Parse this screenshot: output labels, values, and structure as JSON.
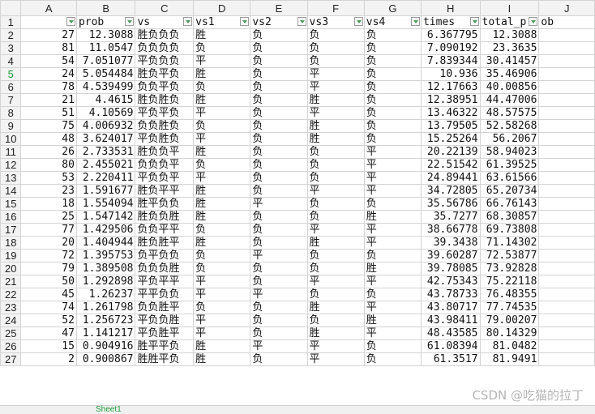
{
  "columns": [
    "A",
    "B",
    "C",
    "D",
    "E",
    "F",
    "G",
    "H",
    "I",
    "J"
  ],
  "header_row": {
    "row": "1",
    "cells": [
      "",
      "prob",
      "vs",
      "vs1",
      "vs2",
      "vs3",
      "vs4",
      "times",
      "total_p",
      "ob"
    ]
  },
  "rows": [
    {
      "n": "2",
      "c": [
        "27",
        "12.3088",
        "胜负负负",
        "胜",
        "负",
        "负",
        "负",
        "6.367795",
        "12.3088",
        ""
      ]
    },
    {
      "n": "3",
      "c": [
        "81",
        "11.0547",
        "负负负负",
        "负",
        "负",
        "负",
        "负",
        "7.090192",
        "23.3635",
        ""
      ]
    },
    {
      "n": "4",
      "c": [
        "54",
        "7.051077",
        "平负负负",
        "平",
        "负",
        "负",
        "负",
        "7.839344",
        "30.41457",
        ""
      ]
    },
    {
      "n": "5",
      "c": [
        "24",
        "5.054484",
        "胜负平负",
        "胜",
        "负",
        "平",
        "负",
        "10.936",
        "35.46906",
        ""
      ]
    },
    {
      "n": "6",
      "c": [
        "78",
        "4.539499",
        "负负平负",
        "负",
        "负",
        "平",
        "负",
        "12.17663",
        "40.00856",
        ""
      ]
    },
    {
      "n": "7",
      "c": [
        "21",
        "4.4615",
        "胜负胜负",
        "胜",
        "负",
        "胜",
        "负",
        "12.38951",
        "44.47006",
        ""
      ]
    },
    {
      "n": "8",
      "c": [
        "51",
        "4.10569",
        "平负平负",
        "平",
        "负",
        "平",
        "负",
        "13.46322",
        "48.57575",
        ""
      ]
    },
    {
      "n": "9",
      "c": [
        "75",
        "4.006932",
        "负负胜负",
        "负",
        "负",
        "胜",
        "负",
        "13.79505",
        "52.58268",
        ""
      ]
    },
    {
      "n": "10",
      "c": [
        "48",
        "3.624017",
        "平负胜负",
        "平",
        "负",
        "胜",
        "负",
        "15.25264",
        "56.2067",
        ""
      ]
    },
    {
      "n": "11",
      "c": [
        "26",
        "2.733531",
        "胜负负平",
        "胜",
        "负",
        "负",
        "平",
        "20.22139",
        "58.94023",
        ""
      ]
    },
    {
      "n": "12",
      "c": [
        "80",
        "2.455021",
        "负负负平",
        "负",
        "负",
        "负",
        "平",
        "22.51542",
        "61.39525",
        ""
      ]
    },
    {
      "n": "13",
      "c": [
        "53",
        "2.220411",
        "平负负平",
        "平",
        "负",
        "负",
        "平",
        "24.89441",
        "63.61566",
        ""
      ]
    },
    {
      "n": "14",
      "c": [
        "23",
        "1.591677",
        "胜负平平",
        "胜",
        "负",
        "平",
        "平",
        "34.72805",
        "65.20734",
        ""
      ]
    },
    {
      "n": "15",
      "c": [
        "18",
        "1.554094",
        "胜平负负",
        "胜",
        "平",
        "负",
        "负",
        "35.56786",
        "66.76143",
        ""
      ]
    },
    {
      "n": "16",
      "c": [
        "25",
        "1.547142",
        "胜负负胜",
        "胜",
        "负",
        "负",
        "胜",
        "35.7277",
        "68.30857",
        ""
      ]
    },
    {
      "n": "17",
      "c": [
        "77",
        "1.429506",
        "负负平平",
        "负",
        "负",
        "平",
        "平",
        "38.66778",
        "69.73808",
        ""
      ]
    },
    {
      "n": "18",
      "c": [
        "20",
        "1.404944",
        "胜负胜平",
        "胜",
        "负",
        "胜",
        "平",
        "39.3438",
        "71.14302",
        ""
      ]
    },
    {
      "n": "19",
      "c": [
        "72",
        "1.395753",
        "负平负负",
        "负",
        "平",
        "负",
        "负",
        "39.60287",
        "72.53877",
        ""
      ]
    },
    {
      "n": "20",
      "c": [
        "79",
        "1.389508",
        "负负负胜",
        "负",
        "负",
        "负",
        "胜",
        "39.78085",
        "73.92828",
        ""
      ]
    },
    {
      "n": "21",
      "c": [
        "50",
        "1.292898",
        "平负平平",
        "平",
        "负",
        "平",
        "平",
        "42.75343",
        "75.22118",
        ""
      ]
    },
    {
      "n": "22",
      "c": [
        "45",
        "1.26237",
        "平平负负",
        "平",
        "平",
        "负",
        "负",
        "43.78733",
        "76.48355",
        ""
      ]
    },
    {
      "n": "23",
      "c": [
        "74",
        "1.261798",
        "负负胜平",
        "负",
        "负",
        "胜",
        "平",
        "43.80717",
        "77.74535",
        ""
      ]
    },
    {
      "n": "24",
      "c": [
        "52",
        "1.256723",
        "平负负胜",
        "平",
        "负",
        "负",
        "胜",
        "43.98411",
        "79.00207",
        ""
      ]
    },
    {
      "n": "25",
      "c": [
        "47",
        "1.141217",
        "平负胜平",
        "平",
        "负",
        "胜",
        "平",
        "48.43585",
        "80.14329",
        ""
      ]
    },
    {
      "n": "26",
      "c": [
        "15",
        "0.904916",
        "胜平平负",
        "胜",
        "平",
        "平",
        "负",
        "61.08394",
        "81.0482",
        ""
      ]
    },
    {
      "n": "27",
      "c": [
        "2",
        "0.900867",
        "胜胜平负",
        "胜",
        "负",
        "平",
        "负",
        "61.3517",
        "81.9491",
        ""
      ]
    }
  ],
  "active_row": "5",
  "sheet_tab": "Sheet1",
  "watermark": "CSDN @吃猫的拉丁",
  "colors": {
    "active_green": "#1e9e3a",
    "header_bg": "#f3f3f3",
    "grid": "#d4d4d4"
  }
}
